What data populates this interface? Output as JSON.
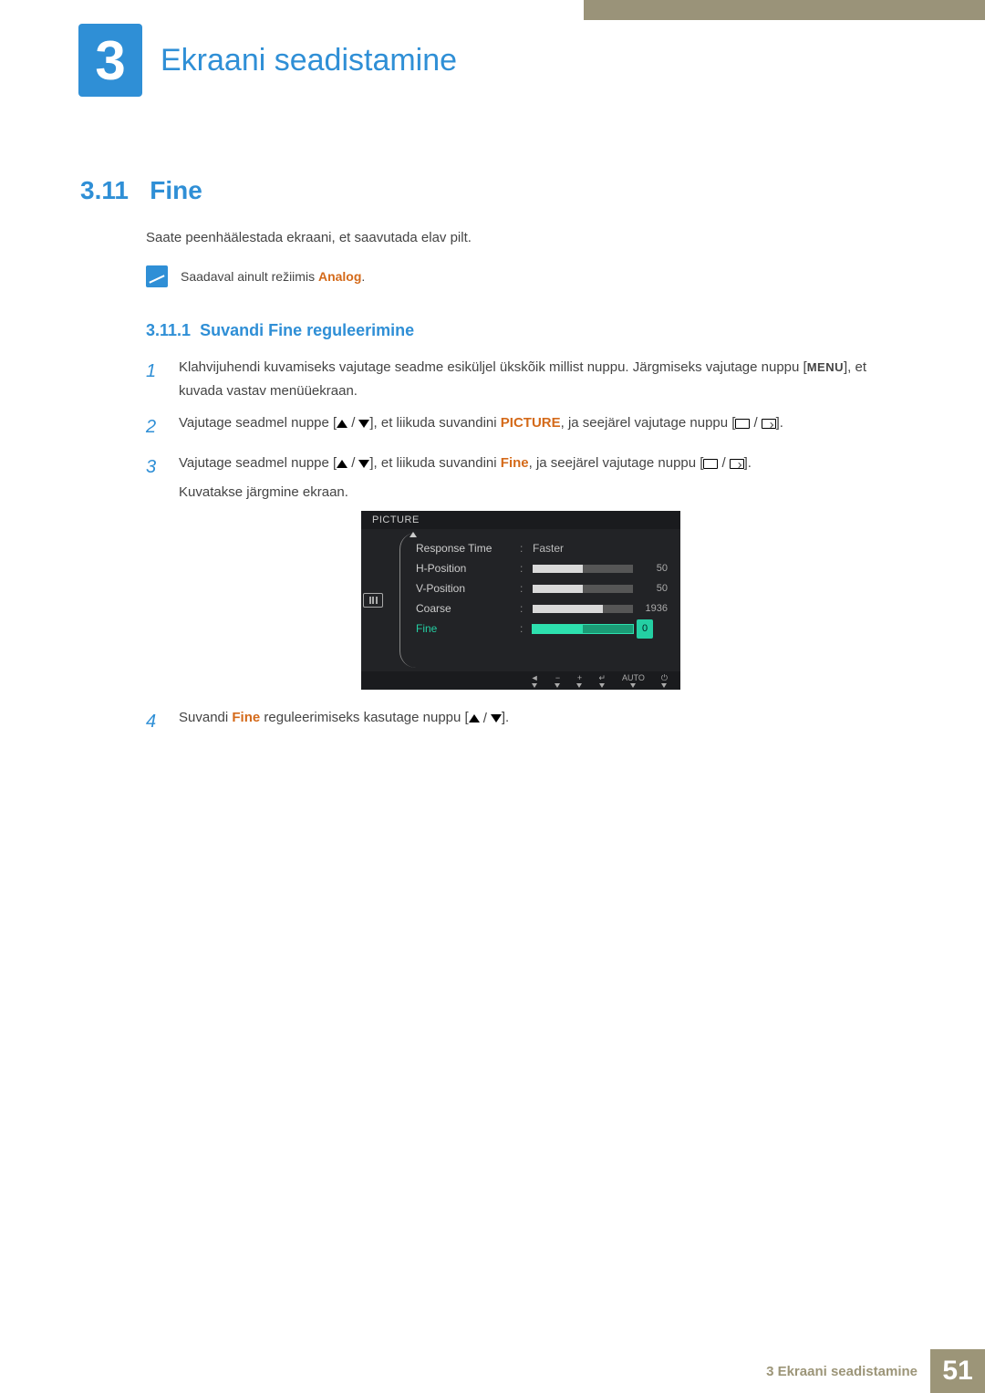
{
  "chapter": {
    "number": "3",
    "title": "Ekraani seadistamine"
  },
  "section": {
    "number": "3.11",
    "title": "Fine",
    "intro": "Saate peenhäälestada ekraani, et saavutada elav pilt."
  },
  "note": {
    "prefix": "Saadaval ainult režiimis ",
    "highlight": "Analog",
    "suffix": "."
  },
  "subsection": {
    "number": "3.11.1",
    "title": "Suvandi Fine reguleerimine"
  },
  "steps": {
    "s1": {
      "num": "1",
      "p1": "Klahvijuhendi kuvamiseks vajutage seadme esiküljel ükskõik millist nuppu. Järgmiseks vajutage nuppu [",
      "menu": "MENU",
      "p2": "], et kuvada vastav menüüekraan."
    },
    "s2": {
      "num": "2",
      "p1": "Vajutage seadmel nuppe [",
      "p2": "], et liikuda suvandini ",
      "hl": "PICTURE",
      "p3": ", ja seejärel vajutage nuppu [",
      "p4": "]."
    },
    "s3": {
      "num": "3",
      "p1": "Vajutage seadmel nuppe [",
      "p2": "], et liikuda suvandini ",
      "hl": "Fine",
      "p3": ", ja seejärel vajutage nuppu [",
      "p4": "].",
      "p5": "Kuvatakse järgmine ekraan."
    },
    "s4": {
      "num": "4",
      "p1": "Suvandi ",
      "hl": "Fine",
      "p2": " reguleerimiseks kasutage nuppu [",
      "p3": "]."
    }
  },
  "osd": {
    "title": "PICTURE",
    "rows": {
      "r0": {
        "label": "Response Time",
        "value": "Faster"
      },
      "r1": {
        "label": "H-Position",
        "num": "50",
        "fill": 50
      },
      "r2": {
        "label": "V-Position",
        "num": "50",
        "fill": 50
      },
      "r3": {
        "label": "Coarse",
        "num": "1936",
        "fill": 70
      },
      "r4": {
        "label": "Fine",
        "num": "0",
        "fill": 50
      }
    },
    "footer": {
      "auto": "AUTO"
    }
  },
  "footer": {
    "text": "3 Ekraani seadistamine",
    "page": "51"
  }
}
